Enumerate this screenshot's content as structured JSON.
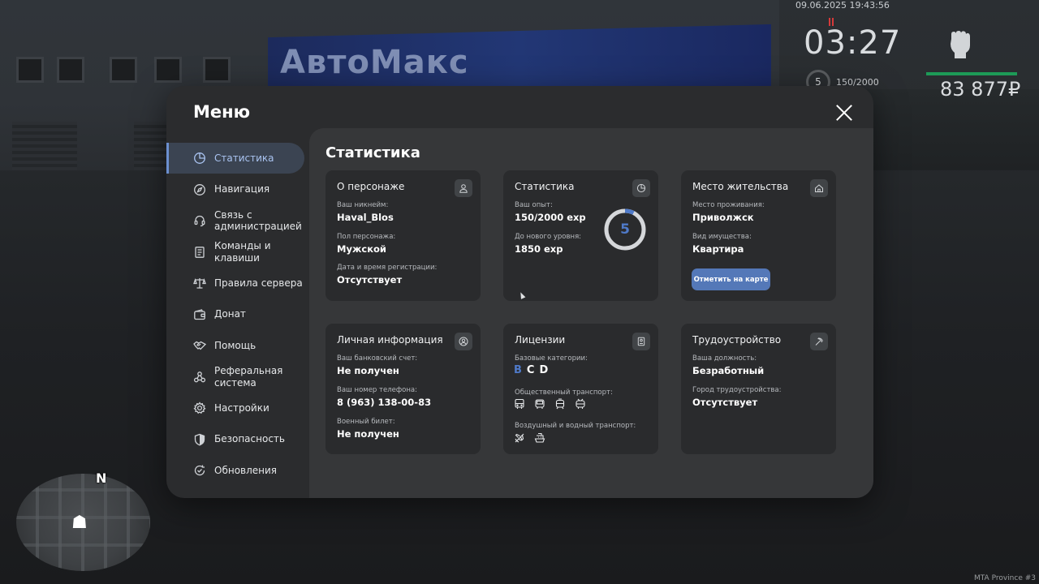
{
  "hud": {
    "datetime": "09.06.2025 19:43:56",
    "clock": "03:27",
    "level": "5",
    "exp": "150/2000",
    "money": "83 877₽",
    "watermark": "MTA Province #3",
    "sign_text": "АвтоМакс",
    "minimap_north": "N",
    "health_color": "#1d9a57"
  },
  "menu": {
    "title": "Меню",
    "close_icon": "close-icon",
    "sidebar": [
      {
        "label": "Статистика",
        "icon": "pie-chart-icon",
        "active": true
      },
      {
        "label": "Навигация",
        "icon": "compass-icon",
        "active": false
      },
      {
        "label": "Связь с администрацией",
        "icon": "headset-icon",
        "active": false
      },
      {
        "label": "Команды и клавиши",
        "icon": "document-icon",
        "active": false
      },
      {
        "label": "Правила сервера",
        "icon": "scales-icon",
        "active": false
      },
      {
        "label": "Донат",
        "icon": "wallet-icon",
        "active": false
      },
      {
        "label": "Помощь",
        "icon": "handshake-icon",
        "active": false
      },
      {
        "label": "Реферальная система",
        "icon": "network-icon",
        "active": false
      },
      {
        "label": "Настройки",
        "icon": "gear-icon",
        "active": false
      },
      {
        "label": "Безопасность",
        "icon": "shield-icon",
        "active": false
      },
      {
        "label": "Обновления",
        "icon": "refresh-check-icon",
        "active": false
      }
    ]
  },
  "content": {
    "title": "Статистика",
    "character": {
      "title": "О персонаже",
      "nickname_label": "Ваш никнейм:",
      "nickname": "Haval_Blos",
      "gender_label": "Пол персонажа:",
      "gender": "Мужской",
      "reg_label": "Дата и время регистрации:",
      "reg": "Отсутствует"
    },
    "stats": {
      "title": "Статистика",
      "exp_label": "Ваш опыт:",
      "exp": "150/2000 exp",
      "next_label": "До нового уровня:",
      "next": "1850 exp",
      "level": "5",
      "progress": 0.075,
      "accent": "#4f7ac9"
    },
    "residence": {
      "title": "Место жительства",
      "place_label": "Место проживания:",
      "place": "Приволжск",
      "type_label": "Вид имущества:",
      "type": "Квартира",
      "map_button": "Отметить на карте",
      "button_color": "#5478b8"
    },
    "personal": {
      "title": "Личная информация",
      "bank_label": "Ваш банковский счет:",
      "bank": "Не получен",
      "phone_label": "Ваш номер телефона:",
      "phone": "8 (963) 138-00-83",
      "military_label": "Военный билет:",
      "military": "Не получен"
    },
    "licenses": {
      "title": "Лицензии",
      "base_label": "Базовые категории:",
      "categories": [
        {
          "letter": "B",
          "active": true
        },
        {
          "letter": "C",
          "active": false
        },
        {
          "letter": "D",
          "active": false
        }
      ],
      "public_label": "Общественный транспорт:",
      "public_icons": [
        "bus-icon",
        "bus-front-icon",
        "tram-icon",
        "trolleybus-icon"
      ],
      "air_label": "Воздушный и водный транспорт:",
      "air_icons": [
        "plane-icon",
        "boat-icon"
      ]
    },
    "employment": {
      "title": "Трудоустройство",
      "position_label": "Ваша должность:",
      "position": "Безработный",
      "city_label": "Город трудоустройства:",
      "city": "Отсутствует"
    }
  }
}
